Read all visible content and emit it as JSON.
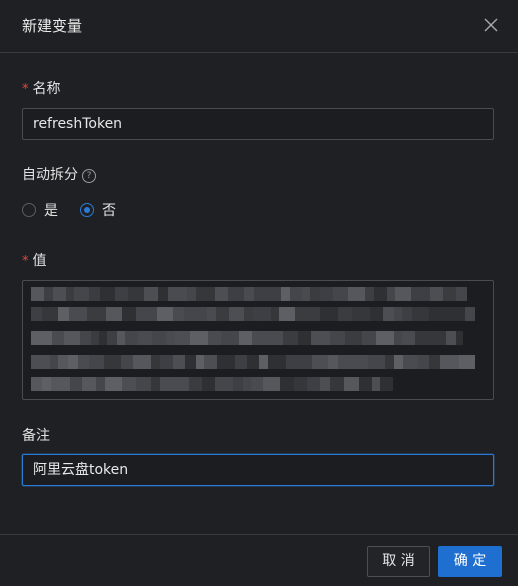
{
  "dialog": {
    "title": "新建变量",
    "close_icon": "close-icon"
  },
  "form": {
    "name": {
      "label": "名称",
      "required_mark": "*",
      "value": "refreshToken"
    },
    "auto_split": {
      "label": "自动拆分",
      "help_icon": "question-circle-icon",
      "help_glyph": "?",
      "options": [
        {
          "label": "是",
          "checked": false
        },
        {
          "label": "否",
          "checked": true
        }
      ]
    },
    "value": {
      "label": "值",
      "required_mark": "*",
      "content_state": "pixelated"
    },
    "note": {
      "label": "备注",
      "value": "阿里云盘token"
    }
  },
  "footer": {
    "cancel_label": "取 消",
    "ok_label": "确 定"
  },
  "colors": {
    "accent": "#1f6fd0",
    "required": "#e5483d",
    "background": "#1f2023"
  }
}
